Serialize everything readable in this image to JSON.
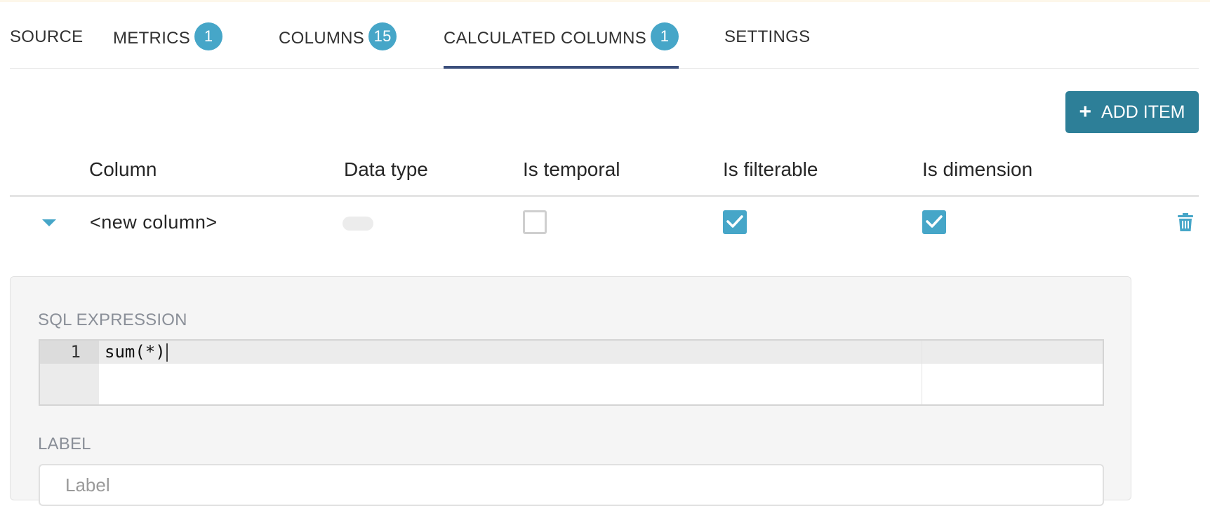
{
  "tabs": [
    {
      "label": "SOURCE",
      "badge": null
    },
    {
      "label": "METRICS",
      "badge": "1"
    },
    {
      "label": "COLUMNS",
      "badge": "15"
    },
    {
      "label": "CALCULATED COLUMNS",
      "badge": "1",
      "active": true
    },
    {
      "label": "SETTINGS",
      "badge": null
    }
  ],
  "add_button": {
    "label": "ADD ITEM",
    "icon": "plus-icon"
  },
  "table": {
    "headers": [
      "Column",
      "Data type",
      "Is temporal",
      "Is filterable",
      "Is dimension"
    ],
    "rows": [
      {
        "column": "<new column>",
        "data_type": "",
        "is_temporal": false,
        "is_filterable": true,
        "is_dimension": true,
        "expanded": true
      }
    ]
  },
  "detail": {
    "sql_expression_label": "SQL EXPRESSION",
    "sql_line_number": "1",
    "sql_code": "sum(*)",
    "label_label": "LABEL",
    "label_placeholder": "Label",
    "label_value": ""
  },
  "colors": {
    "accent": "#46a6c8",
    "button": "#2d7f98",
    "active_tab_underline": "#3b4f7c"
  }
}
